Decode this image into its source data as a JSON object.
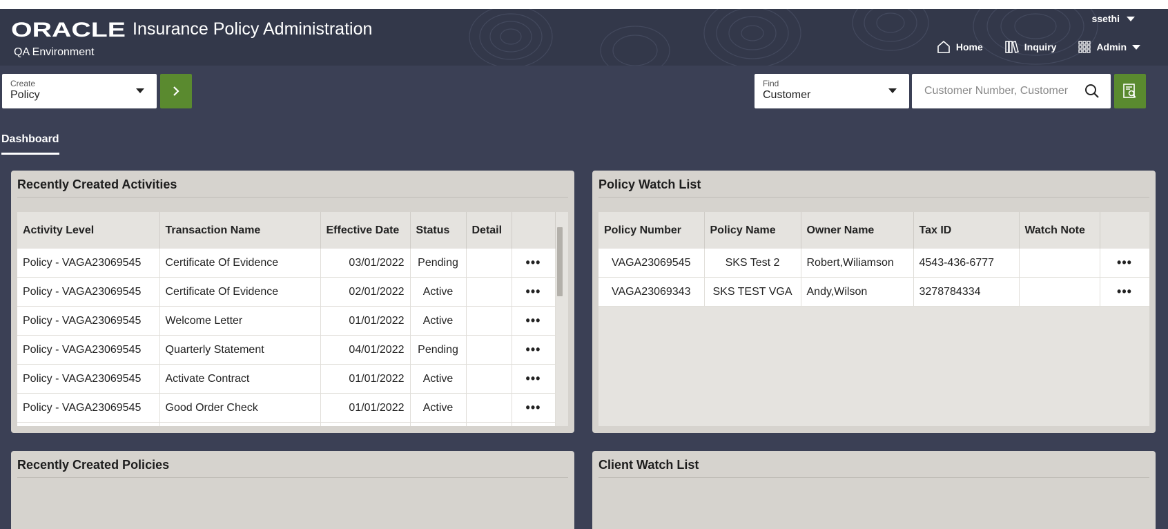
{
  "header": {
    "logo_text": "ORACLE",
    "app_title": "Insurance Policy Administration",
    "environment": "QA Environment",
    "user": "ssethi",
    "nav": {
      "home": "Home",
      "inquiry": "Inquiry",
      "admin": "Admin"
    }
  },
  "create": {
    "label": "Create",
    "value": "Policy"
  },
  "find": {
    "label": "Find",
    "value": "Customer",
    "search_placeholder": "Customer Number, Customer"
  },
  "tabs": {
    "dashboard": "Dashboard"
  },
  "recent_activities": {
    "title": "Recently Created Activities",
    "columns": [
      "Activity Level",
      "Transaction Name",
      "Effective Date",
      "Status",
      "Detail"
    ],
    "rows": [
      {
        "level": "Policy - VAGA23069545",
        "transaction": "Certificate Of Evidence",
        "date": "03/01/2022",
        "status": "Pending"
      },
      {
        "level": "Policy - VAGA23069545",
        "transaction": "Certificate Of Evidence",
        "date": "02/01/2022",
        "status": "Active"
      },
      {
        "level": "Policy - VAGA23069545",
        "transaction": "Welcome Letter",
        "date": "01/01/2022",
        "status": "Active"
      },
      {
        "level": "Policy - VAGA23069545",
        "transaction": "Quarterly Statement",
        "date": "04/01/2022",
        "status": "Pending"
      },
      {
        "level": "Policy - VAGA23069545",
        "transaction": "Activate Contract",
        "date": "01/01/2022",
        "status": "Active"
      },
      {
        "level": "Policy - VAGA23069545",
        "transaction": "Good Order Check",
        "date": "01/01/2022",
        "status": "Active"
      }
    ]
  },
  "policy_watch": {
    "title": "Policy Watch List",
    "columns": [
      "Policy Number",
      "Policy Name",
      "Owner Name",
      "Tax ID",
      "Watch Note"
    ],
    "rows": [
      {
        "number": "VAGA23069545",
        "name": "SKS Test 2",
        "owner": "Robert,Wiliamson",
        "tax_id": "4543-436-6777",
        "note": ""
      },
      {
        "number": "VAGA23069343",
        "name": "SKS TEST VGA",
        "owner": "Andy,Wilson",
        "tax_id": "3278784334",
        "note": ""
      }
    ]
  },
  "recent_policies": {
    "title": "Recently Created Policies"
  },
  "client_watch": {
    "title": "Client Watch List"
  },
  "more_actions": "•••",
  "colors": {
    "header_bg": "#33384a",
    "page_bg": "#3b4055",
    "accent_green": "#5a8a2f",
    "panel_bg": "#d6d3ce"
  }
}
